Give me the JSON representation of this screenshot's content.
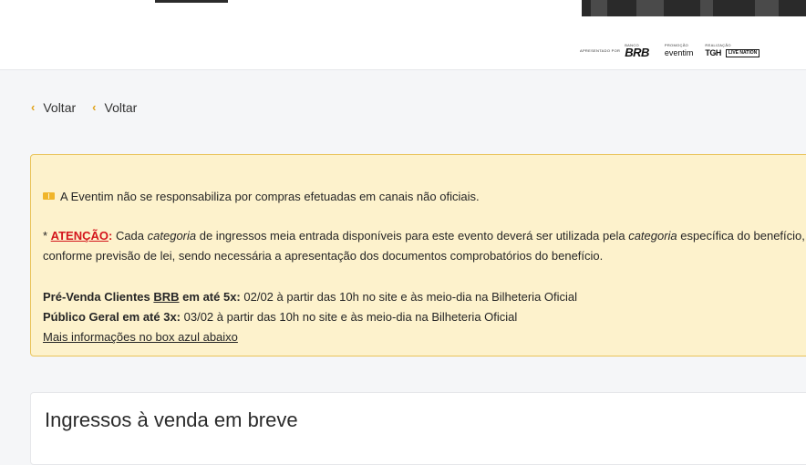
{
  "sponsors": {
    "presented_by_label": "APRESENTADO POR",
    "bank_label": "BANCO",
    "bank_logo": "BRB",
    "promoted_by_label": "PROMOÇÃO",
    "promoter_logo": "eventim",
    "realization_label": "REALIZAÇÃO",
    "realizer_logo_1": "TGH",
    "realizer_logo_2": "LIVE NATION"
  },
  "nav": {
    "back_1": "Voltar",
    "back_2": "Voltar"
  },
  "notice": {
    "line1": "A Eventim não se responsabiliza por compras efetuadas em canais não oficiais.",
    "asterisk": "* ",
    "atencao": "ATENÇÃO",
    "colon": ":",
    "l2_a": " Cada ",
    "l2_em1": "categoria",
    "l2_b": " de ingressos meia entrada disponíveis para este evento deverá ser utilizada pela ",
    "l2_em2": "categoria",
    "l2_c": " específica do benefício,",
    "line3": "conforme previsão de lei, sendo necessária a apresentação dos documentos comprobatórios do benefício.",
    "presale_bold_a": "Pré-Venda Clientes ",
    "presale_bold_brb": "BRB",
    "presale_bold_b": " em até 5x:",
    "presale_text": " 02/02 à partir das 10h no site e às meio-dia na Bilheteria Oficial",
    "general_bold": "Público Geral em até 3x:",
    "general_text": " 03/02 à partir das 10h no site e às meio-dia na Bilheteria Oficial",
    "more_info": "Mais informações no box azul abaixo"
  },
  "tickets": {
    "title": "Ingressos à venda em breve"
  },
  "colors": {
    "accent": "#e0a21a",
    "notice_bg": "#fdf2cc",
    "notice_border": "#e9c45a",
    "alert": "#d4161c"
  }
}
